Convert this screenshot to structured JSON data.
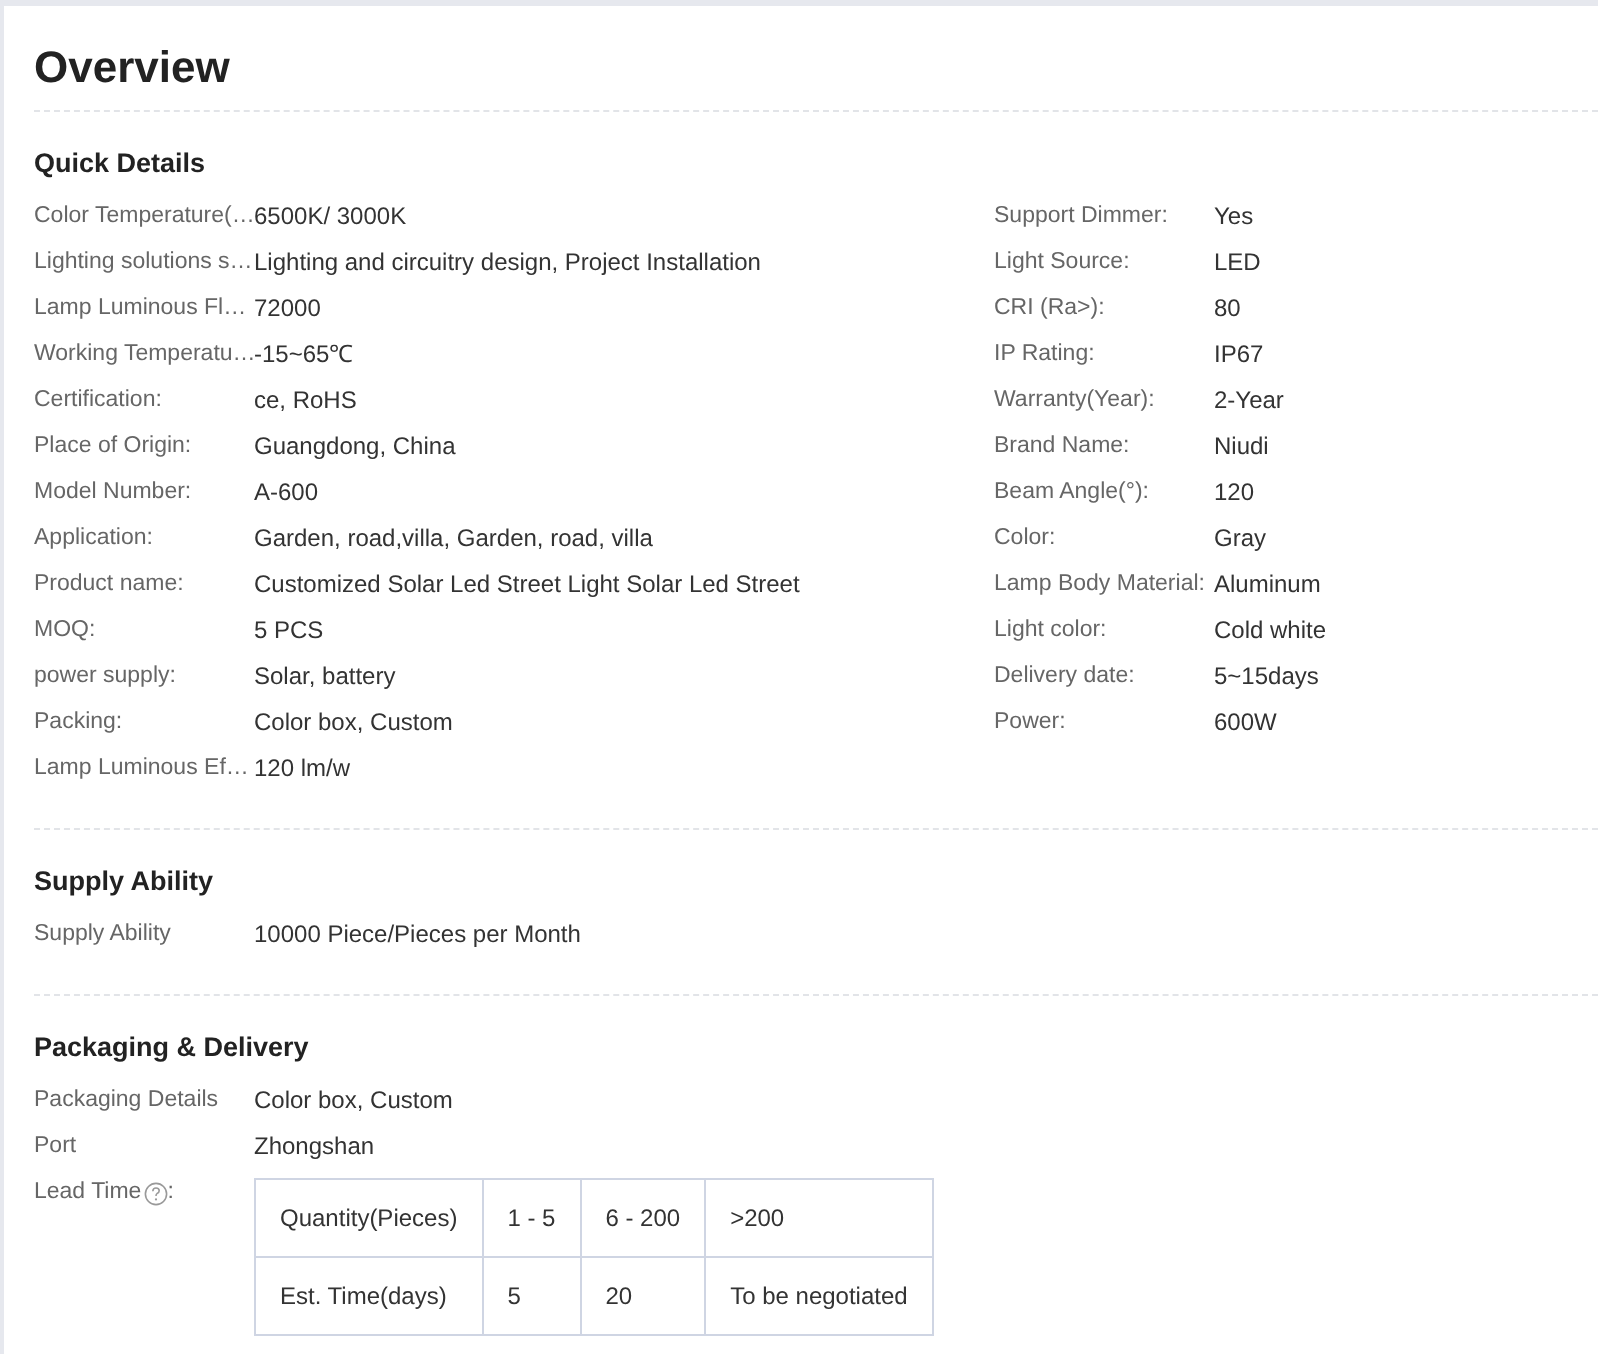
{
  "title": "Overview",
  "sections": [
    {
      "heading": "Quick Details",
      "columns": [
        [
          {
            "label": "Color Temperature(…",
            "value": "6500K/ 3000K"
          },
          {
            "label": "Lighting solutions s…",
            "value": "Lighting and circuitry design, Project Installation"
          },
          {
            "label": "Lamp Luminous Fl…",
            "value": "72000"
          },
          {
            "label": "Working Temperatu…",
            "value": "-15~65℃"
          },
          {
            "label": "Certification:",
            "value": "ce, RoHS"
          },
          {
            "label": "Place of Origin:",
            "value": "Guangdong, China"
          },
          {
            "label": "Model Number:",
            "value": "A-600"
          },
          {
            "label": "Application:",
            "value": "Garden, road,villa, Garden, road, villa"
          },
          {
            "label": "Product name:",
            "value": "Customized Solar Led Street Light Solar Led Street"
          },
          {
            "label": "MOQ:",
            "value": "5 PCS"
          },
          {
            "label": "power supply:",
            "value": "Solar, battery"
          },
          {
            "label": "Packing:",
            "value": "Color box, Custom"
          },
          {
            "label": "Lamp Luminous Ef…",
            "value": "120 lm/w"
          }
        ],
        [
          {
            "label": "Support Dimmer:",
            "value": "Yes"
          },
          {
            "label": "Light Source:",
            "value": "LED"
          },
          {
            "label": "CRI (Ra>):",
            "value": "80"
          },
          {
            "label": "IP Rating:",
            "value": "IP67"
          },
          {
            "label": "Warranty(Year):",
            "value": "2-Year"
          },
          {
            "label": "Brand Name:",
            "value": "Niudi"
          },
          {
            "label": "Beam Angle(°):",
            "value": "120"
          },
          {
            "label": "Color:",
            "value": "Gray"
          },
          {
            "label": "Lamp Body Material:",
            "value": "Aluminum"
          },
          {
            "label": "Light color:",
            "value": "Cold white"
          },
          {
            "label": "Delivery date:",
            "value": "5~15days"
          },
          {
            "label": "Power:",
            "value": "600W"
          }
        ]
      ]
    },
    {
      "heading": "Supply Ability",
      "columns": [
        [
          {
            "label": "Supply Ability",
            "value": "10000 Piece/Pieces per Month"
          }
        ]
      ]
    },
    {
      "heading": "Packaging & Delivery",
      "columns": [
        [
          {
            "label": "Packaging Details",
            "value": "Color box, Custom"
          },
          {
            "label": "Port",
            "value": "Zhongshan"
          }
        ]
      ],
      "lead_time": {
        "label": "Lead Time",
        "suffix": ":",
        "table": [
          [
            "Quantity(Pieces)",
            "1 - 5",
            "6 - 200",
            ">200"
          ],
          [
            "Est. Time(days)",
            "5",
            "20",
            "To be negotiated"
          ]
        ]
      }
    }
  ]
}
